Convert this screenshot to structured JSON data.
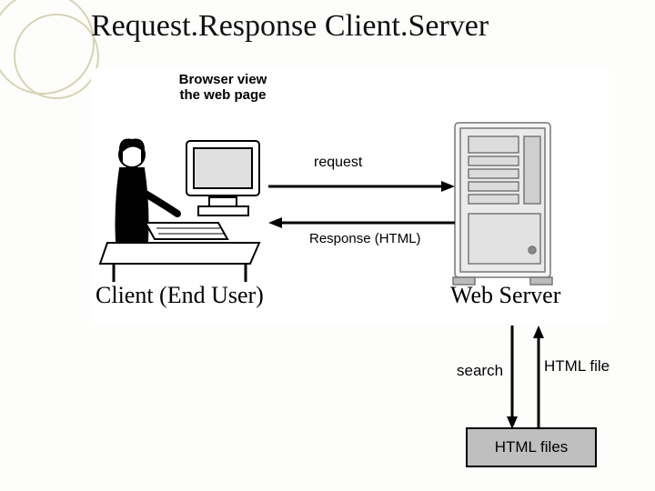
{
  "title": "Request.Response Client.Server",
  "labels": {
    "browser": "Browser view the web page",
    "request": "request",
    "response": "Response (HTML)",
    "client": "Client (End User)",
    "server": "Web Server",
    "search": "search",
    "html_file": "HTML file",
    "html_files_box": "HTML files"
  }
}
